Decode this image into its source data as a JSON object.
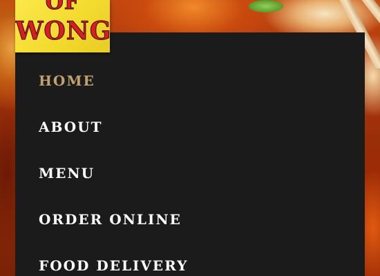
{
  "logo": {
    "line1": "OF",
    "line2": "WONG"
  },
  "nav": {
    "items": [
      {
        "label": "HOME",
        "active": true
      },
      {
        "label": "ABOUT",
        "active": false
      },
      {
        "label": "MENU",
        "active": false
      },
      {
        "label": "ORDER ONLINE",
        "active": false
      },
      {
        "label": "FOOD DELIVERY",
        "active": false
      }
    ]
  },
  "colors": {
    "nav_background": "#1b1b1b",
    "nav_text": "#ffffff",
    "nav_active": "#c3a271",
    "logo_background": "#f2d92d",
    "logo_text": "#d81e1e"
  }
}
